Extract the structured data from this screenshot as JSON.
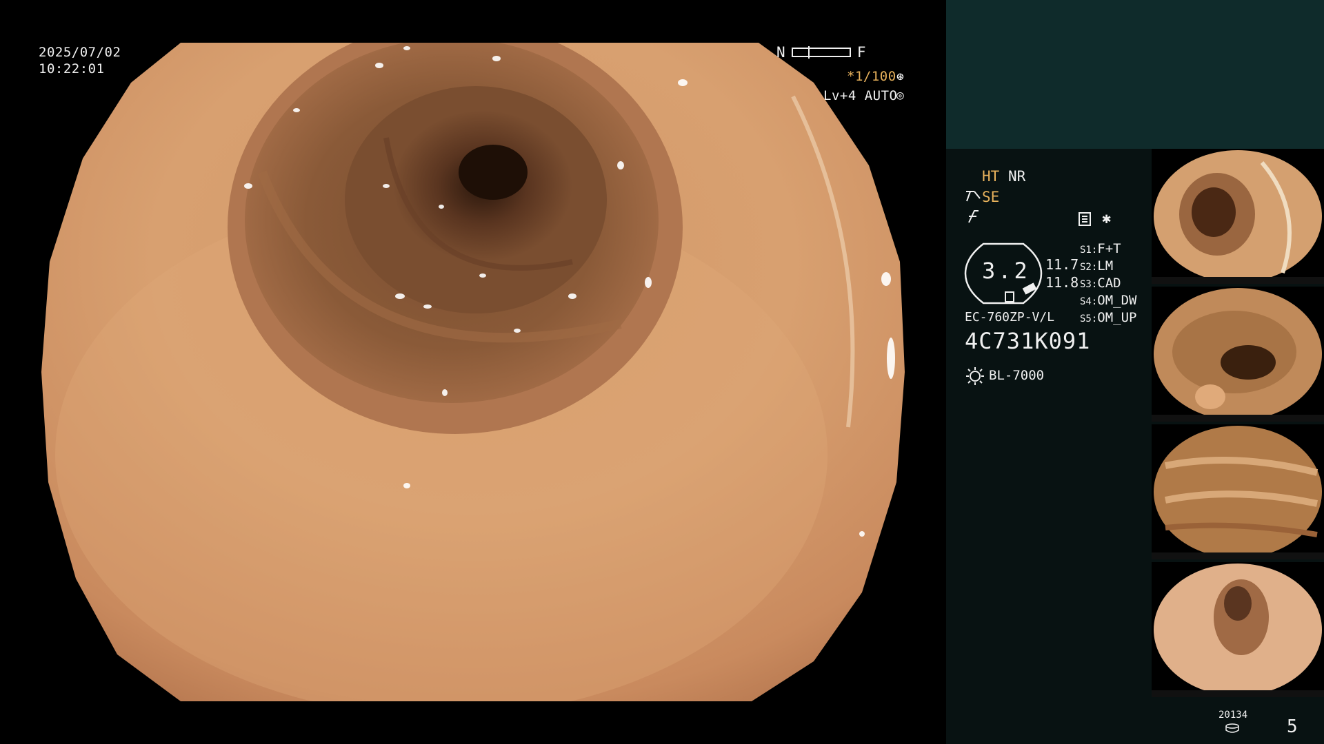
{
  "osd": {
    "date": "2025/07/02",
    "time": "10:22:01",
    "near_far": {
      "n_label": "N",
      "f_label": "F"
    },
    "shutter": "*1/100",
    "level": "Lv+4 AUTO"
  },
  "panel": {
    "ht_label": "HT",
    "nr_label": "NR",
    "se_label": "SE",
    "zoom_value": "3.2",
    "zoom_readout_1": "11.7",
    "zoom_readout_2": "11.8",
    "switches": [
      {
        "key": "S1:",
        "value": "F+T"
      },
      {
        "key": "S2:",
        "value": "LM"
      },
      {
        "key": "S3:",
        "value": "CAD"
      },
      {
        "key": "S4:",
        "value": "OM_DW"
      },
      {
        "key": "S5:",
        "value": "OM_UP"
      }
    ],
    "scope_model": "EC-760ZP-V/L",
    "scope_serial": "4C731K091",
    "light_source": "BL-7000",
    "image_count": "20134",
    "page_number": "5"
  },
  "icons": {
    "shutter": "aperture-icon",
    "auto": "auto-iris-icon",
    "structure": "structure-enhance-icon",
    "freeze": "freeze-icon",
    "settings": "settings-list-icon",
    "light": "lamp-icon",
    "storage": "disk-icon"
  },
  "colors": {
    "accent_orange": "#e8b25c",
    "panel_bg": "#081212",
    "panel_top": "#0f2b2b",
    "osd_text": "#f0f0f0"
  }
}
